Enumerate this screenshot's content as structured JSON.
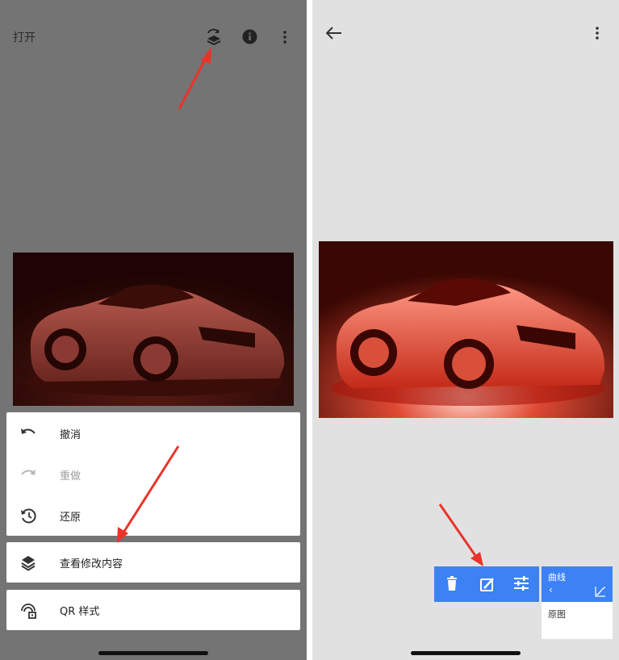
{
  "left_screen": {
    "header": {
      "open_label": "打开",
      "icons": [
        "stack-history-icon",
        "info-icon",
        "more-vert-icon"
      ]
    },
    "undo_menu": {
      "items": [
        {
          "label": "撤消",
          "icon": "undo-icon",
          "enabled": true
        },
        {
          "label": "重做",
          "icon": "redo-icon",
          "enabled": false
        },
        {
          "label": "还原",
          "icon": "restore-icon",
          "enabled": true
        }
      ]
    },
    "view_edits": {
      "label": "查看修改内容",
      "icon": "layers-icon"
    },
    "qr_style": {
      "label": "QR 样式",
      "icon": "qr-style-icon"
    }
  },
  "right_screen": {
    "header": {
      "icons": [
        "back-arrow-icon",
        "more-vert-icon"
      ]
    },
    "edit_toolbar": {
      "icons": [
        "delete-icon",
        "edit-brush-icon",
        "tune-icon"
      ],
      "color": "#3c82f4"
    },
    "edit_stack": {
      "filter_name": "曲线",
      "back_glyph": "‹",
      "curve_icon": "curves-icon",
      "original_label": "原图"
    }
  },
  "colors": {
    "dim_overlay": "#747474",
    "sheet_background": "#ffffff",
    "accent_blue": "#3c82f4",
    "annotation_arrow": "#e8342a",
    "photo_red": "#d8311f"
  }
}
